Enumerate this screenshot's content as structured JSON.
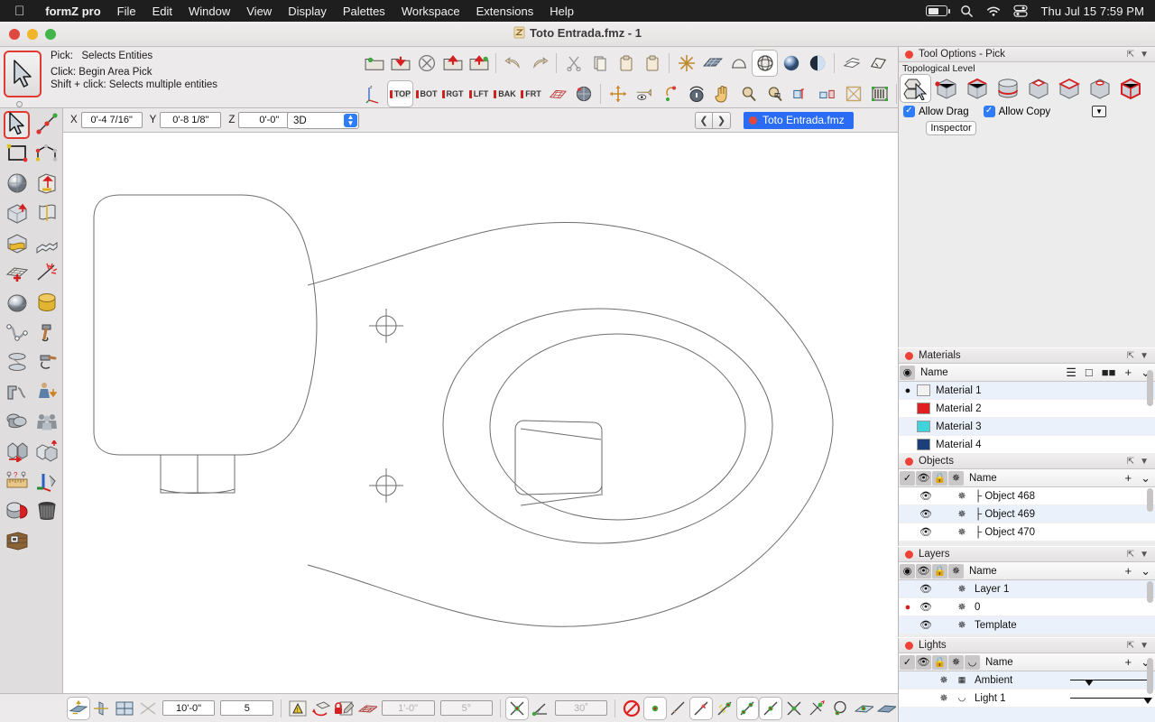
{
  "menubar": {
    "apple_icon": "apple-logo",
    "app_name": "formZ pro",
    "items": [
      "File",
      "Edit",
      "Window",
      "View",
      "Display",
      "Palettes",
      "Workspace",
      "Extensions",
      "Help"
    ],
    "status": {
      "battery_icon": "battery-icon",
      "search_icon": "search-icon",
      "wifi_icon": "wifi-icon",
      "control_center_icon": "control-center-icon",
      "clock": "Thu Jul 15  7:59 PM"
    }
  },
  "window": {
    "title": "Toto Entrada.fmz - 1",
    "doc_icon": "formz-document-icon",
    "traffic": [
      "close-button",
      "minimize-button",
      "zoom-button"
    ]
  },
  "hint": {
    "tool_icon": "arrow-pick-cursor-icon",
    "line1_label": "Pick:",
    "line1_value": "Selects Entities",
    "line2": "Click: Begin Area Pick",
    "line3": "Shift + click: Selects multiple entities"
  },
  "toolbar": {
    "row1": [
      {
        "name": "new-project-icon",
        "glyph": "🗀"
      },
      {
        "name": "open-project-icon",
        "glyph": "📥"
      },
      {
        "name": "close-project-icon",
        "glyph": "⊗"
      },
      {
        "name": "save-project-icon",
        "glyph": "📤"
      },
      {
        "name": "save-as-project-icon",
        "glyph": "🗂"
      },
      {
        "name": "undo-icon",
        "glyph": "↶"
      },
      {
        "name": "redo-icon",
        "glyph": "↷"
      },
      {
        "name": "cut-icon",
        "glyph": "✂"
      },
      {
        "name": "copy-icon",
        "glyph": "⧉"
      },
      {
        "name": "paste-icon",
        "glyph": "📋"
      },
      {
        "name": "paste-in-place-icon",
        "glyph": "🗒"
      },
      {
        "name": "ghosted-display-icon",
        "glyph": "✳"
      },
      {
        "name": "wireframe-display-icon",
        "glyph": "▒"
      },
      {
        "name": "shaded-display-icon",
        "glyph": "◔"
      },
      {
        "name": "hidden-line-display-icon",
        "glyph": "◎"
      },
      {
        "name": "surface-render-icon",
        "glyph": "●"
      },
      {
        "name": "shaded-render-icon",
        "glyph": "◑"
      },
      {
        "name": "layers-display-icon",
        "glyph": "❐"
      },
      {
        "name": "keyframe-icon",
        "glyph": "🖍"
      },
      {
        "name": "volume-icon",
        "glyph": "⬡"
      },
      {
        "name": "pencil-edit-icon",
        "glyph": "✏"
      }
    ],
    "row2_views": [
      "TOP",
      "BOT",
      "RGT",
      "LFT",
      "BAK",
      "FRT"
    ],
    "row2": [
      {
        "name": "axes-icon",
        "glyph": "↯"
      },
      {
        "name": "grid-plane-icon",
        "glyph": "▦"
      },
      {
        "name": "sphere-view-icon",
        "glyph": "⚫"
      },
      {
        "name": "orbit-icon",
        "glyph": "✣"
      },
      {
        "name": "walk-through-icon",
        "glyph": "👁"
      },
      {
        "name": "turn-icon",
        "glyph": "↺"
      },
      {
        "name": "mouse-nav-icon",
        "glyph": "🖱"
      },
      {
        "name": "pan-hand-icon",
        "glyph": "✋"
      },
      {
        "name": "zoom-in-icon",
        "glyph": "🔍"
      },
      {
        "name": "zoom-window-icon",
        "glyph": "🔎"
      },
      {
        "name": "zoom-extents-icon",
        "glyph": "⤢"
      },
      {
        "name": "fit-view-icon",
        "glyph": "⤧"
      },
      {
        "name": "fit-all-icon",
        "glyph": "⛶"
      },
      {
        "name": "reference-plane-icon",
        "glyph": "▤"
      },
      {
        "name": "split-view-icon",
        "glyph": "◫"
      },
      {
        "name": "clip-icon",
        "glyph": "⬚"
      }
    ]
  },
  "coordbar": {
    "x_label": "X",
    "x_value": "0'-4 7/16\"",
    "y_label": "Y",
    "y_value": "0'-8 1/8\"",
    "z_label": "Z",
    "z_value": "0'-0\"",
    "mode": "3D",
    "prev_icon": "chevron-left-icon",
    "next_icon": "chevron-right-icon",
    "doc_tab": "Toto Entrada.fmz"
  },
  "left_palette": [
    {
      "name": "pick-tool",
      "glyph": "➤",
      "selected": true
    },
    {
      "name": "segment-tool",
      "glyph": "╱"
    },
    {
      "name": "rectangle-tool",
      "glyph": "▭"
    },
    {
      "name": "polyline-tool",
      "glyph": "⭔"
    },
    {
      "name": "sphere-tool",
      "glyph": "◕"
    },
    {
      "name": "extrude-tool",
      "glyph": "↥"
    },
    {
      "name": "cube-tool",
      "glyph": "⬛"
    },
    {
      "name": "sweep-tool",
      "glyph": "∿"
    },
    {
      "name": "patch-tool",
      "glyph": "◧"
    },
    {
      "name": "stair-tool",
      "glyph": "⬚"
    },
    {
      "name": "mesh-tool",
      "glyph": "⊞"
    },
    {
      "name": "break-tool",
      "glyph": "✶"
    },
    {
      "name": "revolve-tool",
      "glyph": "●"
    },
    {
      "name": "cylinder-tool",
      "glyph": "⬭"
    },
    {
      "name": "nurbs-curve-tool",
      "glyph": "∼"
    },
    {
      "name": "hammer-tool",
      "glyph": "🔨"
    },
    {
      "name": "lathe-tool",
      "glyph": "◈"
    },
    {
      "name": "deform-tool",
      "glyph": "⚒"
    },
    {
      "name": "profile-tool",
      "glyph": "⫫"
    },
    {
      "name": "figure-tool",
      "glyph": "👤"
    },
    {
      "name": "boolean-union-tool",
      "glyph": "◐"
    },
    {
      "name": "group-tool",
      "glyph": "👥"
    },
    {
      "name": "move-tool",
      "glyph": "⬌"
    },
    {
      "name": "duplicate-tool",
      "glyph": "⧉"
    },
    {
      "name": "measure-tool",
      "glyph": "📏"
    },
    {
      "name": "axis-tool",
      "glyph": "✛"
    },
    {
      "name": "paint-tool",
      "glyph": "🪣"
    },
    {
      "name": "trash-tool",
      "glyph": "🗑"
    },
    {
      "name": "texture-map-tool",
      "glyph": "▦"
    }
  ],
  "tool_options": {
    "title": "Tool Options - Pick",
    "section_label": "Topological Level",
    "levels": [
      {
        "name": "topological-auto-level",
        "selected": true
      },
      {
        "name": "point-level"
      },
      {
        "name": "segment-level"
      },
      {
        "name": "outline-level"
      },
      {
        "name": "face-level"
      },
      {
        "name": "face-group-level"
      },
      {
        "name": "hole-level"
      },
      {
        "name": "object-level"
      }
    ],
    "allow_drag_label": "Allow Drag",
    "allow_drag_checked": true,
    "allow_copy_label": "Allow Copy",
    "allow_copy_checked": true,
    "popup_icon": "popup-menu-icon",
    "inspector_label": "Inspector"
  },
  "materials": {
    "title": "Materials",
    "col_name": "Name",
    "view_icons": [
      "list-view-icon",
      "large-view-icon",
      "grid-view-icon"
    ],
    "add_icon": "plus-icon",
    "menu_icon": "chevron-down-icon",
    "rows": [
      {
        "name": "Material 1",
        "color": "#f2f2f2",
        "active": true
      },
      {
        "name": "Material 2",
        "color": "#e02020",
        "active": false
      },
      {
        "name": "Material 3",
        "color": "#3fd4dd",
        "active": false
      },
      {
        "name": "Material 4",
        "color": "#1a3f7a",
        "active": false
      }
    ]
  },
  "objects": {
    "title": "Objects",
    "col_name": "Name",
    "header_icons": [
      "check-icon",
      "eye-icon",
      "lock-icon",
      "snap-icon"
    ],
    "add_icon": "plus-icon",
    "menu_icon": "chevron-down-icon",
    "rows": [
      {
        "name": "Object 468"
      },
      {
        "name": "Object 469"
      },
      {
        "name": "Object 470"
      }
    ]
  },
  "layers": {
    "title": "Layers",
    "col_name": "Name",
    "header_icons": [
      "radio-icon",
      "eye-icon",
      "lock-icon",
      "snap-icon"
    ],
    "add_icon": "plus-icon",
    "menu_icon": "chevron-down-icon",
    "rows": [
      {
        "name": "Layer 1",
        "active": false
      },
      {
        "name": "0",
        "active": true
      },
      {
        "name": "Template",
        "active": false
      }
    ]
  },
  "lights": {
    "title": "Lights",
    "col_name": "Name",
    "header_icons": [
      "check-icon",
      "eye-icon",
      "lock-icon",
      "snap-icon",
      "shade-icon"
    ],
    "add_icon": "plus-icon",
    "menu_icon": "chevron-down-icon",
    "rows": [
      {
        "name": "Ambient",
        "level": 18
      },
      {
        "name": "Light 1",
        "level": 96
      }
    ]
  },
  "statusbar": {
    "buttons_left": [
      {
        "name": "reference-plane-icon",
        "glyph": "◱",
        "selected": true
      },
      {
        "name": "plane-edit-icon",
        "glyph": "⧐"
      },
      {
        "name": "grid-snap-icon",
        "glyph": "⊞"
      },
      {
        "name": "plane-rotate-icon",
        "glyph": "✕"
      }
    ],
    "grid_module": "10'-0\"",
    "grid_subdivision": "5",
    "buttons_mid": [
      {
        "name": "perspective-icon",
        "glyph": "△"
      },
      {
        "name": "rotate-plane-icon",
        "glyph": "↻"
      },
      {
        "name": "lock-plane-icon",
        "glyph": "🔒"
      },
      {
        "name": "grid-display-icon",
        "glyph": "▓"
      }
    ],
    "snap_module": "1'-0\"",
    "snap_angle_field": "5°",
    "buttons_snap": [
      {
        "name": "snap-none-icon",
        "glyph": "✳",
        "selected": true
      },
      {
        "name": "snap-angle-icon",
        "glyph": "∠"
      }
    ],
    "angle_value": "30˚",
    "buttons_right": [
      {
        "name": "no-snap-icon",
        "glyph": "⃠"
      },
      {
        "name": "snap-to-point-icon",
        "glyph": "✦",
        "selected": true
      },
      {
        "name": "snap-to-segment-icon",
        "glyph": "╱"
      },
      {
        "name": "snap-to-line-icon",
        "glyph": "∕",
        "selected": true
      },
      {
        "name": "snap-to-grid-icon",
        "glyph": "∷"
      },
      {
        "name": "snap-to-endpoint-icon",
        "glyph": "⁙",
        "selected": true
      },
      {
        "name": "snap-to-midpoint-icon",
        "glyph": "⁄",
        "selected": true
      },
      {
        "name": "snap-intersection-icon",
        "glyph": "✕"
      },
      {
        "name": "snap-tangent-icon",
        "glyph": "✶"
      },
      {
        "name": "snap-center-icon",
        "glyph": "◯"
      },
      {
        "name": "snap-surface-icon",
        "glyph": "▱"
      },
      {
        "name": "snap-face-icon",
        "glyph": "▰"
      }
    ]
  },
  "canvas": {
    "name": "modeling-viewport",
    "background": "#ffffff",
    "line_color": "#6d6d6d",
    "description": "Top view 2D outline drawing of a Toto Entrada toilet: tank at left, bowl at right with inner rim and water spot, two crosshair markers between tank and bowl."
  }
}
